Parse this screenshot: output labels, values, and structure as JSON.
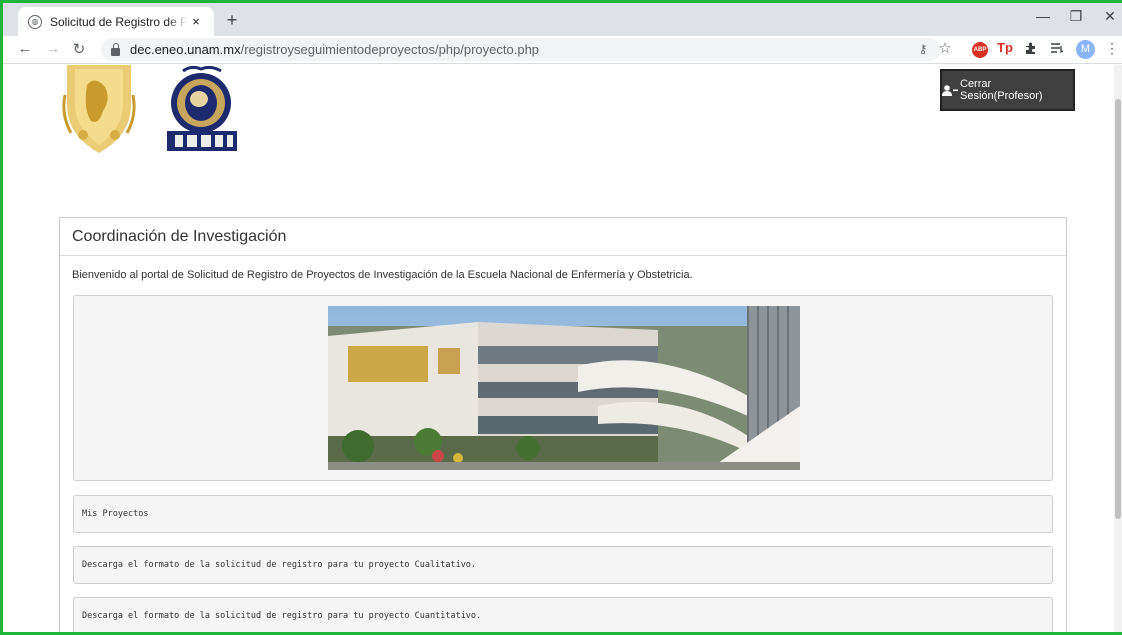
{
  "browser": {
    "tab_title": "Solicitud de Registro de Proyectos",
    "tab_close": "×",
    "new_tab": "+",
    "url_host": "dec.eneo.unam.mx",
    "url_path": "/registroyseguimientodeproyectos/php/proyecto.php",
    "profile_initial": "M",
    "abp_label": "ABP",
    "tp_label": "Tp",
    "window_minimize": "—",
    "window_restore": "❐",
    "window_close": "✕"
  },
  "header": {
    "logout_label": "Cerrar Sesión(Profesor)"
  },
  "panel": {
    "title": "Coordinación de Investigación",
    "welcome": "Bienvenido al portal de Solicitud de Registro de Proyectos de Investigación de la Escuela Nacional de Enfermería y Obstetricia."
  },
  "links": [
    {
      "label": "Mis Proyectos"
    },
    {
      "label": "Descarga el formato de la solicitud de registro para tu proyecto Cualitativo."
    },
    {
      "label": "Descarga el formato de la solicitud de registro para tu proyecto Cuantitativo."
    }
  ],
  "colors": {
    "frame": "#1eb53a",
    "button_bg": "#404040",
    "well_bg": "#f5f5f5"
  }
}
